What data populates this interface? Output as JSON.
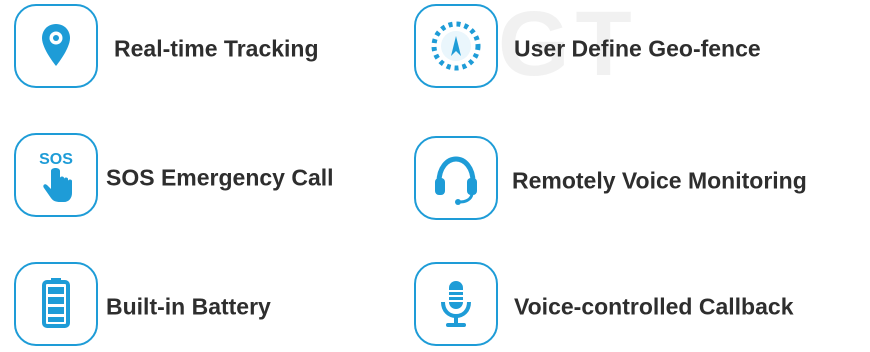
{
  "colors": {
    "accent": "#1e9cd7",
    "text": "#2e2e2e"
  },
  "watermark": "GT",
  "features": [
    {
      "label": "Real-time Tracking",
      "icon": "location-pin-icon"
    },
    {
      "label": "User Define Geo-fence",
      "icon": "geofence-icon"
    },
    {
      "label": "SOS Emergency Call",
      "icon": "sos-hand-icon"
    },
    {
      "label": "Remotely Voice Monitoring",
      "icon": "headset-icon"
    },
    {
      "label": "Built-in Battery",
      "icon": "battery-icon"
    },
    {
      "label": "Voice-controlled Callback",
      "icon": "microphone-icon"
    }
  ]
}
